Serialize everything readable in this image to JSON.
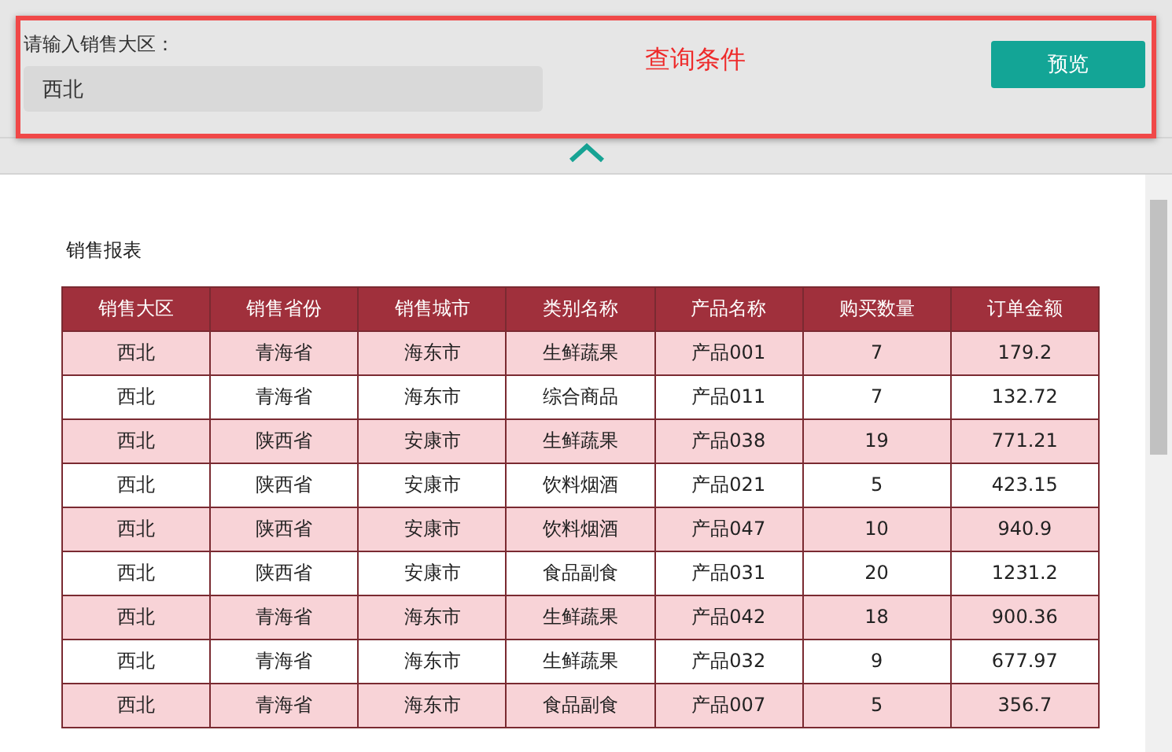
{
  "query_panel": {
    "field_label": "请输入销售大区：",
    "region_field": {
      "value": "西北"
    },
    "preview_button": "预览",
    "annotation": "查询条件"
  },
  "report": {
    "title": "销售报表",
    "table": {
      "columns": [
        "销售大区",
        "销售省份",
        "销售城市",
        "类别名称",
        "产品名称",
        "购买数量",
        "订单金额"
      ],
      "rows": [
        [
          "西北",
          "青海省",
          "海东市",
          "生鲜蔬果",
          "产品001",
          "7",
          "179.2"
        ],
        [
          "西北",
          "青海省",
          "海东市",
          "综合商品",
          "产品011",
          "7",
          "132.72"
        ],
        [
          "西北",
          "陕西省",
          "安康市",
          "生鲜蔬果",
          "产品038",
          "19",
          "771.21"
        ],
        [
          "西北",
          "陕西省",
          "安康市",
          "饮料烟酒",
          "产品021",
          "5",
          "423.15"
        ],
        [
          "西北",
          "陕西省",
          "安康市",
          "饮料烟酒",
          "产品047",
          "10",
          "940.9"
        ],
        [
          "西北",
          "陕西省",
          "安康市",
          "食品副食",
          "产品031",
          "20",
          "1231.2"
        ],
        [
          "西北",
          "青海省",
          "海东市",
          "生鲜蔬果",
          "产品042",
          "18",
          "900.36"
        ],
        [
          "西北",
          "青海省",
          "海东市",
          "生鲜蔬果",
          "产品032",
          "9",
          "677.97"
        ],
        [
          "西北",
          "青海省",
          "海东市",
          "食品副食",
          "产品007",
          "5",
          "356.7"
        ]
      ]
    }
  }
}
